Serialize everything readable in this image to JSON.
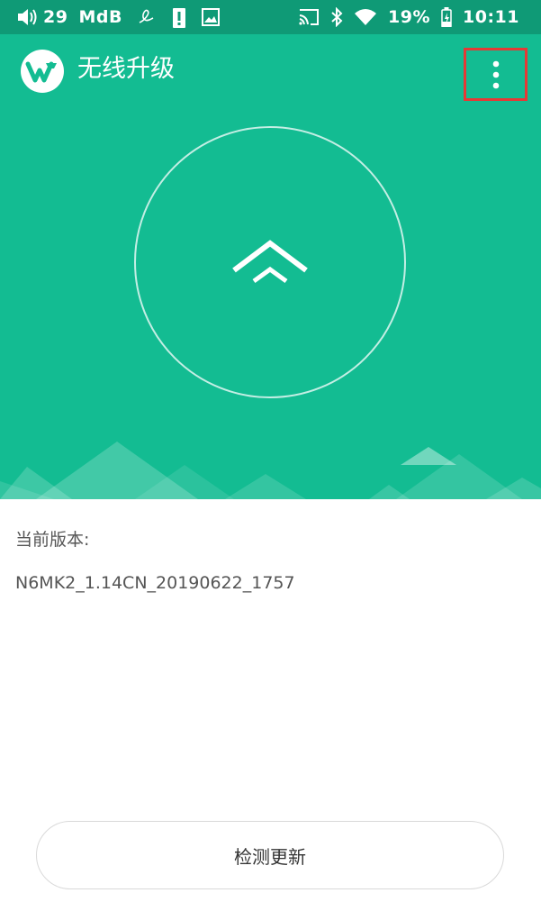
{
  "status_bar": {
    "volume_icon": "speaker-icon",
    "volume_level": "29",
    "unit": "MdB",
    "battery_percent": "19%",
    "time": "10:11",
    "icons": [
      "speaker-icon",
      "signature-icon",
      "alert-icon",
      "image-icon",
      "cast-icon",
      "bluetooth-icon",
      "wifi-icon",
      "battery-charging-icon"
    ]
  },
  "app_bar": {
    "title": "无线升级",
    "logo_icon": "wireless-update-logo-icon",
    "menu_icon": "more-vert-icon"
  },
  "hero": {
    "upgrade_icon": "double-chevron-up-icon"
  },
  "content": {
    "current_version_label": "当前版本:",
    "current_version": "N6MK2_1.14CN_20190622_1757",
    "check_update_button": "检测更新"
  },
  "colors": {
    "status_bar": "#0f9a76",
    "primary": "#13bc92",
    "highlight_border": "#e53935"
  }
}
